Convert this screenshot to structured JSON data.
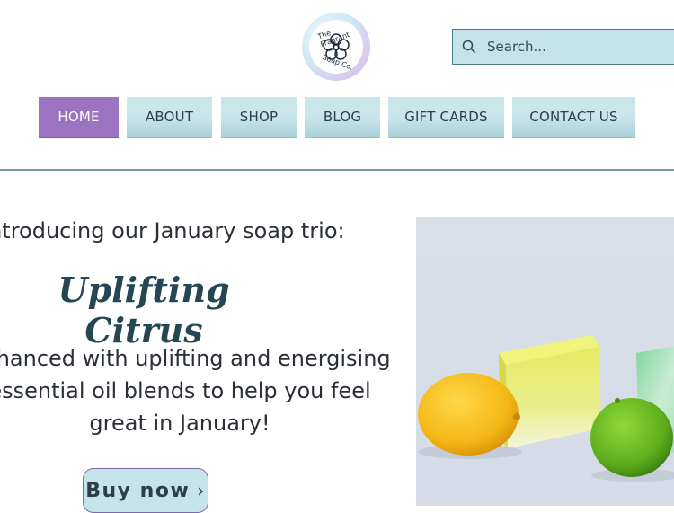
{
  "logo": {
    "line1": "The Fragrant",
    "line2": "Soap Co."
  },
  "search": {
    "placeholder": "Search..."
  },
  "nav": {
    "items": [
      {
        "label": "HOME",
        "active": true
      },
      {
        "label": "ABOUT",
        "active": false
      },
      {
        "label": "SHOP",
        "active": false
      },
      {
        "label": "BLOG",
        "active": false
      },
      {
        "label": "GIFT CARDS",
        "active": false
      },
      {
        "label": "CONTACT US",
        "active": false
      }
    ]
  },
  "hero": {
    "intro": "Introducing our January soap trio:",
    "product_name": "Uplifting Citrus",
    "description_line1": "Enhanced with uplifting and energising",
    "description_line2": "essential oil blends to help you feel",
    "description_line3": "great in January!",
    "button_label": "Buy now"
  },
  "colors": {
    "nav_bg": "#c9e7ea",
    "nav_active": "#9c73c1",
    "search_bg": "#c3e3e8",
    "title_color": "#254653"
  },
  "icons": [
    "flower-logo-icon",
    "search-icon",
    "chevron-right-icon"
  ]
}
